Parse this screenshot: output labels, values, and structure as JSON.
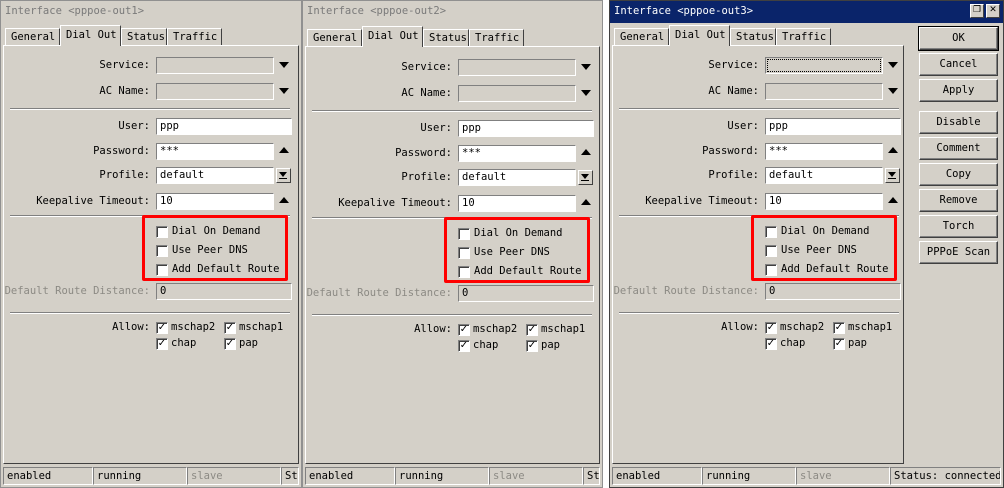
{
  "windows": [
    {
      "title": "Interface <pppoe-out1>",
      "tabs": [
        "General",
        "Dial Out",
        "Status",
        "Traffic"
      ],
      "selected_tab": "Dial Out",
      "fields": {
        "service": {
          "label": "Service:",
          "value": ""
        },
        "ac_name": {
          "label": "AC Name:",
          "value": ""
        },
        "user": {
          "label": "User:",
          "value": "ppp"
        },
        "password": {
          "label": "Password:",
          "value": "***"
        },
        "profile": {
          "label": "Profile:",
          "value": "default"
        },
        "keepalive": {
          "label": "Keepalive Timeout:",
          "value": "10"
        }
      },
      "checkboxes": [
        {
          "label": "Dial On Demand",
          "checked": false
        },
        {
          "label": "Use Peer DNS",
          "checked": false
        },
        {
          "label": "Add Default Route",
          "checked": false
        }
      ],
      "default_route_distance": {
        "label": "Default Route Distance:",
        "value": "0"
      },
      "allow": {
        "label": "Allow:",
        "options": [
          {
            "label": "mschap2",
            "checked": true
          },
          {
            "label": "mschap1",
            "checked": true
          },
          {
            "label": "chap",
            "checked": true
          },
          {
            "label": "pap",
            "checked": true
          }
        ]
      },
      "status": [
        "enabled",
        "running",
        "slave",
        "Sta"
      ]
    },
    {
      "title": "Interface <pppoe-out2>",
      "tabs": [
        "General",
        "Dial Out",
        "Status",
        "Traffic"
      ],
      "selected_tab": "Dial Out",
      "fields": {
        "service": {
          "label": "Service:",
          "value": ""
        },
        "ac_name": {
          "label": "AC Name:",
          "value": ""
        },
        "user": {
          "label": "User:",
          "value": "ppp"
        },
        "password": {
          "label": "Password:",
          "value": "***"
        },
        "profile": {
          "label": "Profile:",
          "value": "default"
        },
        "keepalive": {
          "label": "Keepalive Timeout:",
          "value": "10"
        }
      },
      "checkboxes": [
        {
          "label": "Dial On Demand",
          "checked": false
        },
        {
          "label": "Use Peer DNS",
          "checked": false
        },
        {
          "label": "Add Default Route",
          "checked": false
        }
      ],
      "default_route_distance": {
        "label": "Default Route Distance:",
        "value": "0"
      },
      "allow": {
        "label": "Allow:",
        "options": [
          {
            "label": "mschap2",
            "checked": true
          },
          {
            "label": "mschap1",
            "checked": true
          },
          {
            "label": "chap",
            "checked": true
          },
          {
            "label": "pap",
            "checked": true
          }
        ]
      },
      "status": [
        "enabled",
        "running",
        "slave",
        "Sta"
      ]
    },
    {
      "title": "Interface <pppoe-out3>",
      "tabs": [
        "General",
        "Dial Out",
        "Status",
        "Traffic"
      ],
      "selected_tab": "Dial Out",
      "fields": {
        "service": {
          "label": "Service:",
          "value": ""
        },
        "ac_name": {
          "label": "AC Name:",
          "value": ""
        },
        "user": {
          "label": "User:",
          "value": "ppp"
        },
        "password": {
          "label": "Password:",
          "value": "***"
        },
        "profile": {
          "label": "Profile:",
          "value": "default"
        },
        "keepalive": {
          "label": "Keepalive Timeout:",
          "value": "10"
        }
      },
      "checkboxes": [
        {
          "label": "Dial On Demand",
          "checked": false
        },
        {
          "label": "Use Peer DNS",
          "checked": false
        },
        {
          "label": "Add Default Route",
          "checked": false
        }
      ],
      "default_route_distance": {
        "label": "Default Route Distance:",
        "value": "0"
      },
      "allow": {
        "label": "Allow:",
        "options": [
          {
            "label": "mschap2",
            "checked": true
          },
          {
            "label": "mschap1",
            "checked": true
          },
          {
            "label": "chap",
            "checked": true
          },
          {
            "label": "pap",
            "checked": true
          }
        ]
      },
      "status": [
        "enabled",
        "running",
        "slave",
        "Status: connected"
      ],
      "title_buttons": [
        "restore-icon",
        "close-icon"
      ]
    }
  ],
  "side_buttons": [
    "OK",
    "Cancel",
    "Apply",
    "Disable",
    "Comment",
    "Copy",
    "Remove",
    "Torch",
    "PPPoE Scan"
  ],
  "colors": {
    "window_bg": "#d4d0c8",
    "active_title": "#0a246a",
    "highlight_box": "#ff0000",
    "disabled_text": "#8c8a84"
  }
}
